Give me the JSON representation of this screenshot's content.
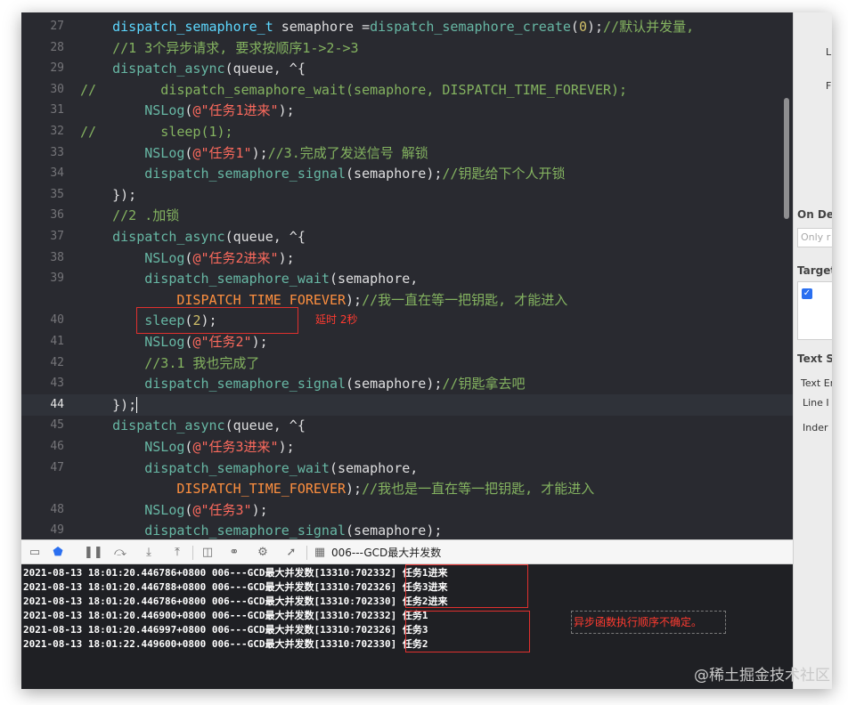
{
  "editor": {
    "lines": [
      {
        "n": "27",
        "segs": [
          [
            "p",
            "    "
          ],
          [
            "t",
            "dispatch_semaphore_t"
          ],
          [
            "p",
            " semaphore ="
          ],
          [
            "f",
            "dispatch_semaphore_create"
          ],
          [
            "p",
            "("
          ],
          [
            "n",
            "0"
          ],
          [
            "p",
            ");"
          ],
          [
            "c",
            "//默认并发量,"
          ]
        ]
      },
      {
        "n": "28",
        "segs": [
          [
            "c",
            "    //1 3个异步请求, 要求按顺序1->2->3"
          ]
        ]
      },
      {
        "n": "29",
        "segs": [
          [
            "p",
            "    "
          ],
          [
            "f",
            "dispatch_async"
          ],
          [
            "p",
            "(queue, ^{"
          ]
        ]
      },
      {
        "n": "30",
        "segs": [
          [
            "c",
            "//        dispatch_semaphore_wait(semaphore, DISPATCH_TIME_FOREVER);"
          ]
        ]
      },
      {
        "n": "31",
        "segs": [
          [
            "p",
            "        "
          ],
          [
            "f",
            "NSLog"
          ],
          [
            "p",
            "("
          ],
          [
            "s",
            "@\"任务1进来\""
          ],
          [
            "p",
            ");"
          ]
        ]
      },
      {
        "n": "32",
        "segs": [
          [
            "c",
            "//        sleep(1);"
          ]
        ]
      },
      {
        "n": "33",
        "segs": [
          [
            "p",
            "        "
          ],
          [
            "f",
            "NSLog"
          ],
          [
            "p",
            "("
          ],
          [
            "s",
            "@\"任务1\""
          ],
          [
            "p",
            ");"
          ],
          [
            "c",
            "//3.完成了发送信号 解锁"
          ]
        ]
      },
      {
        "n": "34",
        "segs": [
          [
            "p",
            "        "
          ],
          [
            "f",
            "dispatch_semaphore_signal"
          ],
          [
            "p",
            "(semaphore);"
          ],
          [
            "c",
            "//钥匙给下个人开锁"
          ]
        ]
      },
      {
        "n": "35",
        "segs": [
          [
            "p",
            "    });"
          ]
        ]
      },
      {
        "n": "36",
        "segs": [
          [
            "c",
            "    //2 .加锁"
          ]
        ]
      },
      {
        "n": "37",
        "segs": [
          [
            "p",
            "    "
          ],
          [
            "f",
            "dispatch_async"
          ],
          [
            "p",
            "(queue, ^{"
          ]
        ]
      },
      {
        "n": "38",
        "segs": [
          [
            "p",
            "        "
          ],
          [
            "f",
            "NSLog"
          ],
          [
            "p",
            "("
          ],
          [
            "s",
            "@\"任务2进来\""
          ],
          [
            "p",
            ");"
          ]
        ]
      },
      {
        "n": "39",
        "segs": [
          [
            "p",
            "        "
          ],
          [
            "f",
            "dispatch_semaphore_wait"
          ],
          [
            "p",
            "(semaphore,"
          ]
        ]
      },
      {
        "n": "",
        "segs": [
          [
            "p",
            "            "
          ],
          [
            "m",
            "DISPATCH_TIME_FOREVER"
          ],
          [
            "p",
            ");"
          ],
          [
            "c",
            "//我一直在等一把钥匙, 才能进入"
          ]
        ]
      },
      {
        "n": "40",
        "segs": [
          [
            "p",
            "        "
          ],
          [
            "f",
            "sleep"
          ],
          [
            "p",
            "("
          ],
          [
            "n",
            "2"
          ],
          [
            "p",
            ");"
          ]
        ]
      },
      {
        "n": "41",
        "segs": [
          [
            "p",
            "        "
          ],
          [
            "f",
            "NSLog"
          ],
          [
            "p",
            "("
          ],
          [
            "s",
            "@\"任务2\""
          ],
          [
            "p",
            ");"
          ]
        ]
      },
      {
        "n": "42",
        "segs": [
          [
            "c",
            "        //3.1 我也完成了"
          ]
        ]
      },
      {
        "n": "43",
        "segs": [
          [
            "p",
            "        "
          ],
          [
            "f",
            "dispatch_semaphore_signal"
          ],
          [
            "p",
            "(semaphore);"
          ],
          [
            "c",
            "//钥匙拿去吧"
          ]
        ]
      },
      {
        "n": "44",
        "segs": [
          [
            "p",
            "    });"
          ]
        ],
        "current": true
      },
      {
        "n": "45",
        "segs": [
          [
            "p",
            "    "
          ],
          [
            "f",
            "dispatch_async"
          ],
          [
            "p",
            "(queue, ^{"
          ]
        ]
      },
      {
        "n": "46",
        "segs": [
          [
            "p",
            "        "
          ],
          [
            "f",
            "NSLog"
          ],
          [
            "p",
            "("
          ],
          [
            "s",
            "@\"任务3进来\""
          ],
          [
            "p",
            ");"
          ]
        ]
      },
      {
        "n": "47",
        "segs": [
          [
            "p",
            "        "
          ],
          [
            "f",
            "dispatch_semaphore_wait"
          ],
          [
            "p",
            "(semaphore,"
          ]
        ]
      },
      {
        "n": "",
        "segs": [
          [
            "p",
            "            "
          ],
          [
            "m",
            "DISPATCH_TIME_FOREVER"
          ],
          [
            "p",
            ");"
          ],
          [
            "c",
            "//我也是一直在等一把钥匙, 才能进入"
          ]
        ]
      },
      {
        "n": "48",
        "segs": [
          [
            "p",
            "        "
          ],
          [
            "f",
            "NSLog"
          ],
          [
            "p",
            "("
          ],
          [
            "s",
            "@\"任务3\""
          ],
          [
            "p",
            ");"
          ]
        ]
      },
      {
        "n": "49",
        "segs": [
          [
            "p",
            "        "
          ],
          [
            "f",
            "dispatch_semaphore_signal"
          ],
          [
            "p",
            "(semaphore);"
          ]
        ]
      }
    ],
    "annotation": "延时 2秒"
  },
  "colors": {
    "background": "#292a30",
    "comment": "#84b360",
    "function": "#67b7a4",
    "type": "#5dd8ff",
    "string": "#fc6a5d",
    "number": "#d0bf69",
    "macro": "#fd8f3f",
    "annotation": "#ff3b30"
  },
  "debug_toolbar": {
    "icons": [
      "hide-debug-area-icon",
      "breakpoints-icon",
      "pause-icon",
      "step-over-icon",
      "step-into-icon",
      "step-out-icon",
      "view-hierarchy-icon",
      "memory-graph-icon",
      "environment-icon",
      "location-icon",
      "target-icon"
    ],
    "target": "006---GCD最大并发数"
  },
  "console": {
    "lines": [
      "2021-08-13 18:01:20.446786+0800 006---GCD最大并发数[13310:702332] 任务1进来",
      "2021-08-13 18:01:20.446788+0800 006---GCD最大并发数[13310:702326] 任务3进来",
      "2021-08-13 18:01:20.446786+0800 006---GCD最大并发数[13310:702330] 任务2进来",
      "2021-08-13 18:01:20.446900+0800 006---GCD最大并发数[13310:702332] 任务1",
      "2021-08-13 18:01:20.446997+0800 006---GCD最大并发数[13310:702326] 任务3",
      "2021-08-13 18:01:22.449600+0800 006---GCD最大并发数[13310:702330] 任务2"
    ],
    "annotation": "异步函数执行顺序不确定。"
  },
  "inspector": {
    "labels": [
      "L",
      "F",
      "On De",
      "Only r",
      "Target",
      "Text S",
      "Text Er",
      "Line I",
      "Inder"
    ]
  },
  "watermark": "@稀土掘金技术社区"
}
